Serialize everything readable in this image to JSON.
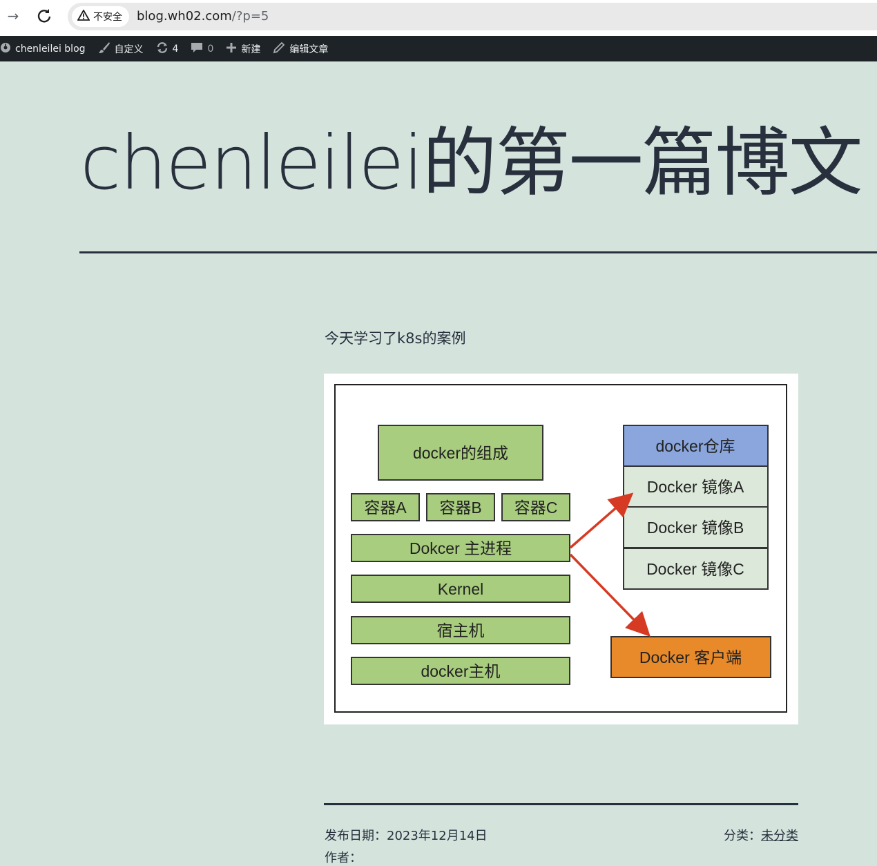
{
  "browser": {
    "security_label": "不安全",
    "url_host": "blog.wh02.com",
    "url_path": "/?p=5"
  },
  "admin_bar": {
    "site_name": "chenleilei blog",
    "customize": "自定义",
    "updates_count": "4",
    "comments_count": "0",
    "new": "新建",
    "edit": "编辑文章"
  },
  "post": {
    "title": "chenleilei的第一篇博文",
    "intro": "今天学习了k8s的案例",
    "published_label": "发布日期：",
    "published_date": "2023年12月14日",
    "category_label": "分类：",
    "category": "未分类",
    "author_label": "作者："
  },
  "diagram": {
    "composition": "docker的组成",
    "containers": [
      "容器A",
      "容器B",
      "容器C"
    ],
    "stack": [
      "Dokcer 主进程",
      "Kernel",
      "宿主机",
      "docker主机"
    ],
    "registry_header": "docker仓库",
    "images": [
      "Docker 镜像A",
      "Docker 镜像B",
      "Docker 镜像C"
    ],
    "client": "Docker 客户端",
    "colors": {
      "green_box": "#a8cd7e",
      "registry_blue": "#8aa6dd",
      "image_bg": "#dce8d9",
      "client_orange": "#e8892a",
      "arrow_red": "#d63a23"
    }
  }
}
